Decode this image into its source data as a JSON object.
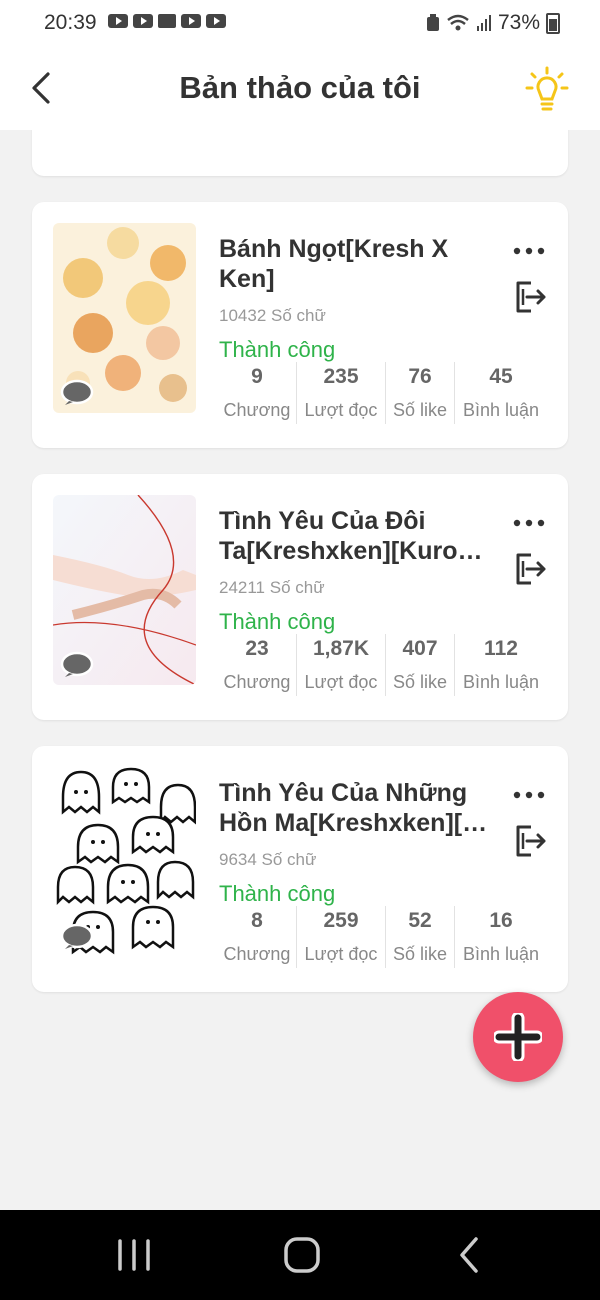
{
  "status_bar": {
    "time": "20:39",
    "battery": "73%"
  },
  "header": {
    "title": "Bản thảo của tôi"
  },
  "stat_labels": {
    "chapters": "Chương",
    "reads": "Lượt đọc",
    "likes": "Số like",
    "comments": "Bình luận"
  },
  "stories": [
    {
      "title": "",
      "words": "",
      "status": "",
      "chapters": "",
      "reads": "",
      "likes": "",
      "comments": ""
    },
    {
      "title": "Bánh Ngọt[Kresh X Ken]",
      "words": "10432 Số chữ",
      "status": "Thành công",
      "chapters": "9",
      "reads": "235",
      "likes": "76",
      "comments": "45"
    },
    {
      "title": "Tình Yêu Của Đôi Ta[Kreshxken][Kuro…",
      "words": "24211 Số chữ",
      "status": "Thành công",
      "chapters": "23",
      "reads": "1,87K",
      "likes": "407",
      "comments": "112"
    },
    {
      "title": "Tình Yêu Của Những Hồn Ma[Kreshxken][…",
      "words": "9634 Số chữ",
      "status": "Thành công",
      "chapters": "8",
      "reads": "259",
      "likes": "52",
      "comments": "16"
    }
  ],
  "colors": {
    "success": "#2fb34a",
    "fab": "#f0506a",
    "bulb": "#f5c518"
  }
}
